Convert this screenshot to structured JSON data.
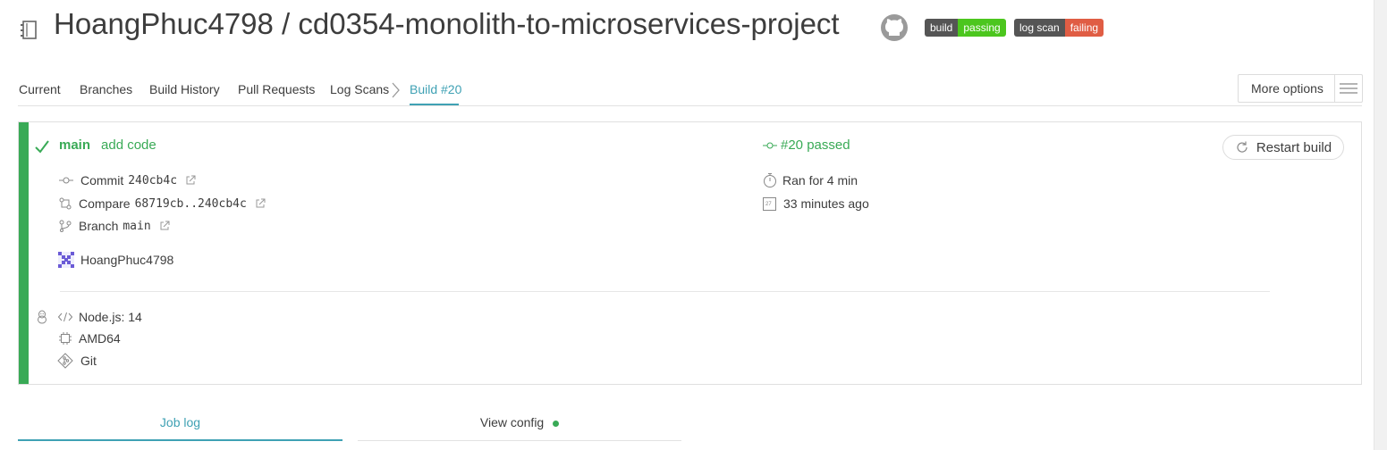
{
  "header": {
    "repo_title": "HoangPhuc4798 / cd0354-monolith-to-microservices-project",
    "badge_build": {
      "left": "build",
      "right": "passing",
      "left_color": "#555555",
      "right_color": "#4cc61e"
    },
    "badge_logscan": {
      "left": "log scan",
      "right": "failing",
      "left_color": "#555555",
      "right_color": "#e05d44"
    }
  },
  "nav": {
    "tabs": [
      "Current",
      "Branches",
      "Build History",
      "Pull Requests",
      "Log Scans",
      "Build #20"
    ],
    "active_color": "#3fa1b4",
    "more_options": "More options"
  },
  "build": {
    "branch": "main",
    "message": "add code",
    "status": "#20 passed",
    "restart": "Restart build",
    "commit_label": "Commit",
    "commit_hash": "240cb4c",
    "compare_label": "Compare",
    "compare_range": "68719cb..240cb4c",
    "branch_label": "Branch",
    "branch_value": "main",
    "author": "HoangPhuc4798",
    "duration": "Ran for 4 min",
    "finished": "33 minutes ago",
    "calendar_day": "27",
    "success_color": "#39aa56"
  },
  "job_config": {
    "language": "Node.js: 14",
    "arch": "AMD64",
    "vcs": "Git"
  },
  "bottom_tabs": {
    "job_log": "Job log",
    "view_config": "View config"
  }
}
